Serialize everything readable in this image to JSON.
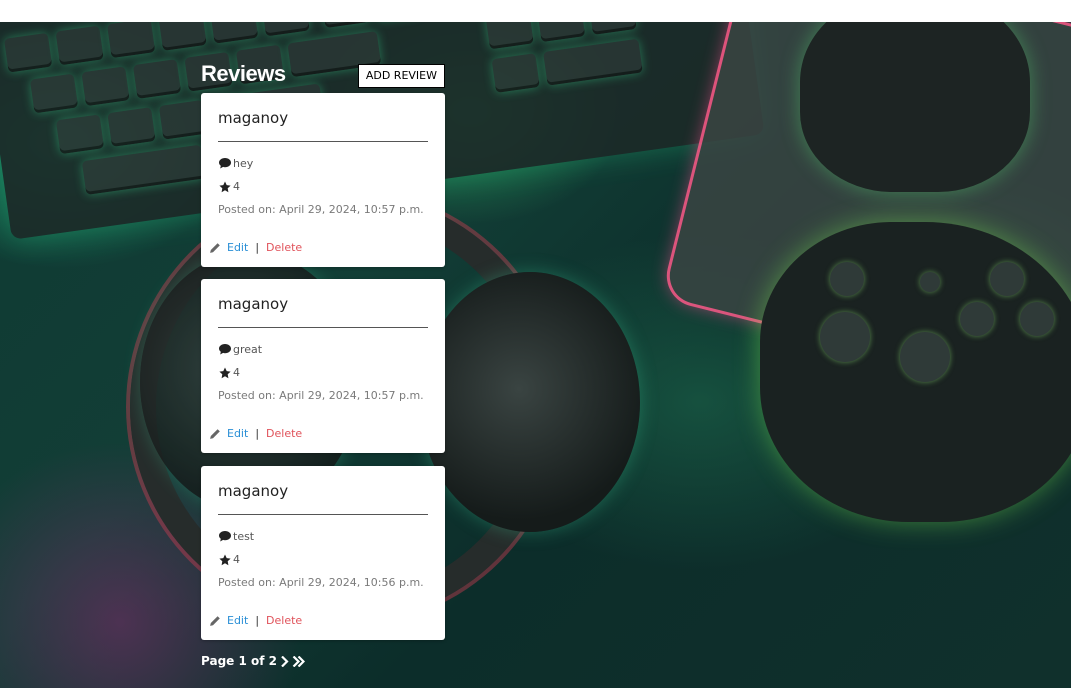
{
  "header": {
    "title": "Reviews",
    "add_review_label": "ADD REVIEW"
  },
  "reviews": [
    {
      "author": "maganoy",
      "comment": "hey",
      "rating": "4",
      "posted": "Posted on: April 29, 2024, 10:57 p.m.",
      "edit_label": "Edit",
      "separator": "|",
      "delete_label": "Delete"
    },
    {
      "author": "maganoy",
      "comment": "great",
      "rating": "4",
      "posted": "Posted on: April 29, 2024, 10:57 p.m.",
      "edit_label": "Edit",
      "separator": "|",
      "delete_label": "Delete"
    },
    {
      "author": "maganoy",
      "comment": "test",
      "rating": "4",
      "posted": "Posted on: April 29, 2024, 10:56 p.m.",
      "edit_label": "Edit",
      "separator": "|",
      "delete_label": "Delete"
    }
  ],
  "pagination": {
    "label": "Page 1 of 2"
  },
  "icons": {
    "comment": "comment-icon",
    "rating": "star-icon",
    "edit": "pencil-icon",
    "next": "chevron-right-icon",
    "last": "double-chevron-right-icon"
  },
  "colors": {
    "edit_link": "#2a8fd6",
    "delete_link": "#e0525a",
    "card_background": "#ffffff"
  }
}
